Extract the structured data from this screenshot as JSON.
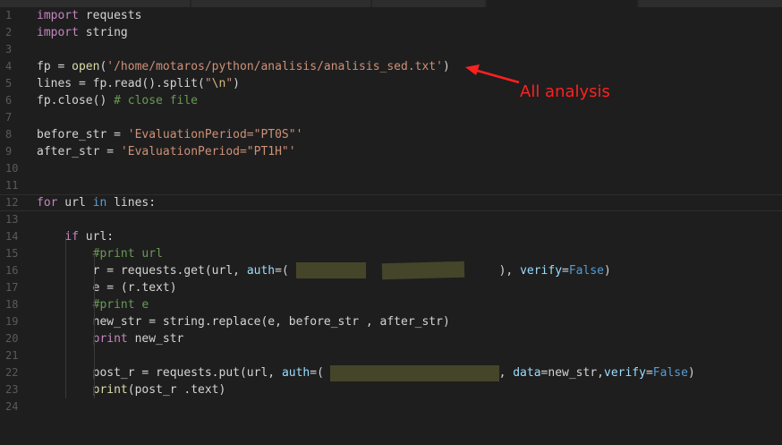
{
  "editor": {
    "lines": [
      {
        "n": "1",
        "segments": [
          {
            "t": "import",
            "c": "kw"
          },
          {
            "t": " requests",
            "c": ""
          }
        ]
      },
      {
        "n": "2",
        "segments": [
          {
            "t": "import",
            "c": "kw"
          },
          {
            "t": " string",
            "c": ""
          }
        ]
      },
      {
        "n": "3",
        "segments": []
      },
      {
        "n": "4",
        "segments": [
          {
            "t": "fp = ",
            "c": ""
          },
          {
            "t": "open",
            "c": "fn"
          },
          {
            "t": "(",
            "c": ""
          },
          {
            "t": "'/home/motaros/python/analisis/analisis_sed.txt'",
            "c": "str"
          },
          {
            "t": ")",
            "c": ""
          }
        ]
      },
      {
        "n": "5",
        "segments": [
          {
            "t": "lines = fp.read().split(",
            "c": ""
          },
          {
            "t": "\"",
            "c": "str"
          },
          {
            "t": "\\n",
            "c": "esc"
          },
          {
            "t": "\"",
            "c": "str"
          },
          {
            "t": ")",
            "c": ""
          }
        ]
      },
      {
        "n": "6",
        "segments": [
          {
            "t": "fp.close() ",
            "c": ""
          },
          {
            "t": "# close file",
            "c": "cm"
          }
        ]
      },
      {
        "n": "7",
        "segments": []
      },
      {
        "n": "8",
        "segments": [
          {
            "t": "before_str = ",
            "c": ""
          },
          {
            "t": "'EvaluationPeriod=\"PT0S\"'",
            "c": "str"
          }
        ]
      },
      {
        "n": "9",
        "segments": [
          {
            "t": "after_str = ",
            "c": ""
          },
          {
            "t": "'EvaluationPeriod=\"PT1H\"'",
            "c": "str"
          }
        ]
      },
      {
        "n": "10",
        "segments": []
      },
      {
        "n": "11",
        "segments": []
      },
      {
        "n": "12",
        "segments": [
          {
            "t": "for",
            "c": "kw"
          },
          {
            "t": " url ",
            "c": ""
          },
          {
            "t": "in",
            "c": "kw2"
          },
          {
            "t": " lines:",
            "c": ""
          }
        ]
      },
      {
        "n": "13",
        "segments": []
      },
      {
        "n": "14",
        "segments": [
          {
            "t": "    ",
            "c": ""
          },
          {
            "t": "if",
            "c": "kw"
          },
          {
            "t": " url:",
            "c": ""
          }
        ]
      },
      {
        "n": "15",
        "segments": [
          {
            "t": "        ",
            "c": ""
          },
          {
            "t": "#print url",
            "c": "cm"
          }
        ]
      },
      {
        "n": "16",
        "segments": [
          {
            "t": "        r = requests.get(url, ",
            "c": ""
          },
          {
            "t": "auth",
            "c": "pm"
          },
          {
            "t": "=(                              ), ",
            "c": ""
          },
          {
            "t": "verify",
            "c": "pm"
          },
          {
            "t": "=",
            "c": ""
          },
          {
            "t": "False",
            "c": "bool"
          },
          {
            "t": ")",
            "c": ""
          }
        ]
      },
      {
        "n": "17",
        "segments": [
          {
            "t": "        e = (r.text)",
            "c": ""
          }
        ]
      },
      {
        "n": "18",
        "segments": [
          {
            "t": "        ",
            "c": ""
          },
          {
            "t": "#print e",
            "c": "cm"
          }
        ]
      },
      {
        "n": "19",
        "segments": [
          {
            "t": "        new_str = string.replace(e, before_str , after_str)",
            "c": ""
          }
        ]
      },
      {
        "n": "20",
        "segments": [
          {
            "t": "        ",
            "c": ""
          },
          {
            "t": "print",
            "c": "kw"
          },
          {
            "t": " new_str",
            "c": ""
          }
        ]
      },
      {
        "n": "21",
        "segments": []
      },
      {
        "n": "22",
        "segments": [
          {
            "t": "        post_r = requests.put(url, ",
            "c": ""
          },
          {
            "t": "auth",
            "c": "pm"
          },
          {
            "t": "=(                        ), ",
            "c": ""
          },
          {
            "t": "data",
            "c": "pm"
          },
          {
            "t": "=new_str,",
            "c": ""
          },
          {
            "t": "verify",
            "c": "pm"
          },
          {
            "t": "=",
            "c": ""
          },
          {
            "t": "False",
            "c": "bool"
          },
          {
            "t": ")",
            "c": ""
          }
        ]
      },
      {
        "n": "23",
        "segments": [
          {
            "t": "        ",
            "c": ""
          },
          {
            "t": "print",
            "c": "fn"
          },
          {
            "t": "(post_r .text)",
            "c": ""
          }
        ]
      },
      {
        "n": "24",
        "segments": []
      }
    ],
    "current_line": "12"
  },
  "annotation": {
    "text": "All analysis",
    "color": "#ff2020"
  }
}
